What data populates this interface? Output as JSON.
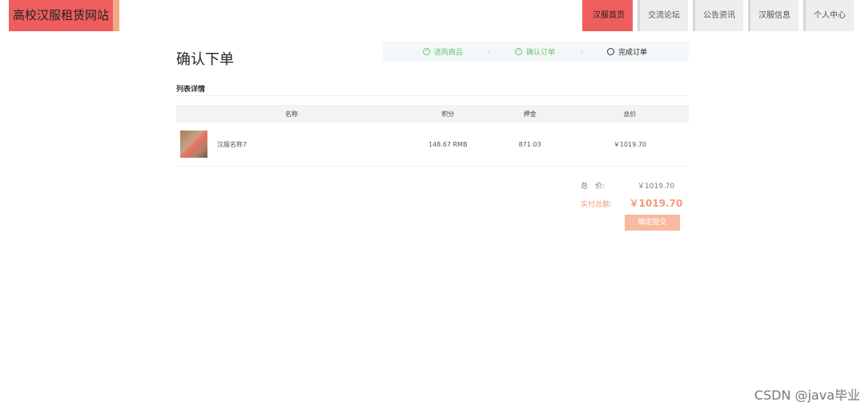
{
  "site": {
    "title": "高校汉服租赁网站"
  },
  "nav": [
    {
      "label": "汉服首页",
      "active": true
    },
    {
      "label": "交流论坛",
      "active": false
    },
    {
      "label": "公告资讯",
      "active": false
    },
    {
      "label": "汉服信息",
      "active": false
    },
    {
      "label": "个人中心",
      "active": false
    }
  ],
  "page": {
    "title": "确认下单"
  },
  "steps": [
    {
      "label": "选购商品",
      "state": "done"
    },
    {
      "label": "确认订单",
      "state": "done"
    },
    {
      "label": "完成订单",
      "state": "current"
    }
  ],
  "section": {
    "title": "列表详情"
  },
  "table": {
    "headers": [
      "名称",
      "积分",
      "押金",
      "总价"
    ],
    "rows": [
      {
        "name": "汉服名称7",
        "points": "148.67 RMB",
        "deposit": "871.03",
        "total": "￥1019.70"
      }
    ]
  },
  "summary": {
    "total_label": "总　价:",
    "total_value": "￥1019.70",
    "paid_label": "实付总额:",
    "paid_value": "￥1019.70",
    "submit_label": "确定提交"
  },
  "watermark": "CSDN @java毕业",
  "colors": {
    "accent": "#ef5e5e",
    "success": "#6cc56c",
    "submit": "#f9b9a0"
  }
}
